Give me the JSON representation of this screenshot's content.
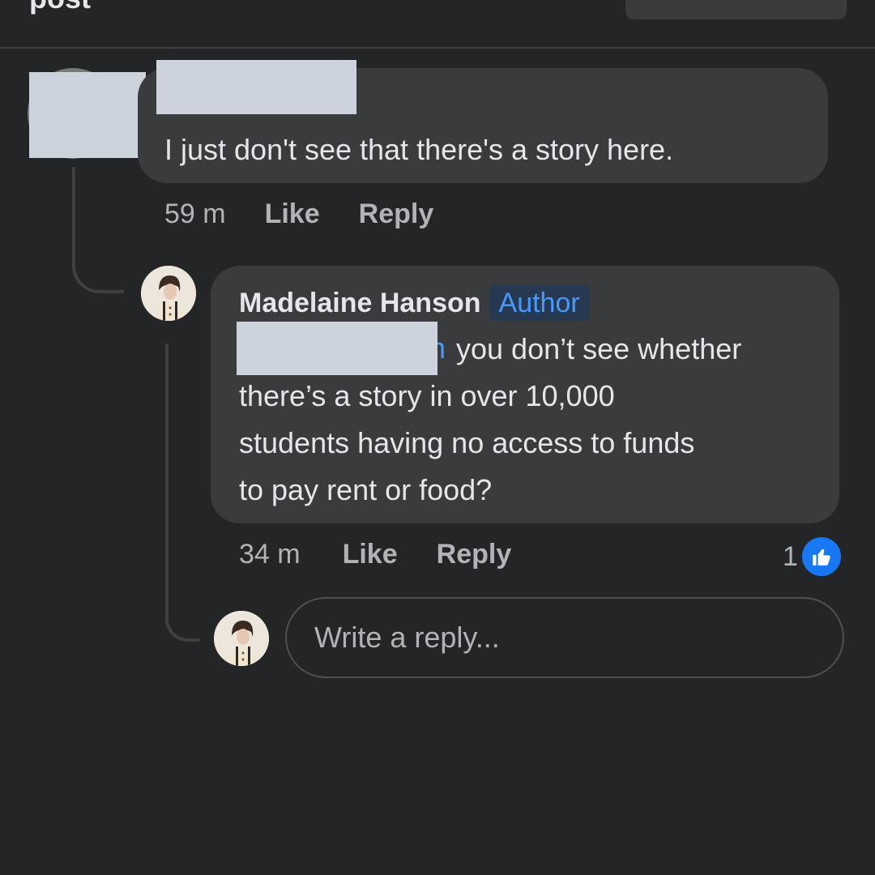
{
  "top": {
    "label": "post"
  },
  "comment": {
    "text": "I just don't see that there's a story here.",
    "timestamp": "59 m",
    "like_label": "Like",
    "reply_label": "Reply"
  },
  "reply": {
    "author_name": "Madelaine Hanson",
    "author_badge": "Author",
    "mention_fragment": "n",
    "lines": [
      "you don’t see whether",
      "there’s a story in over 10,000",
      "students having no access to funds",
      "to pay rent or food?"
    ],
    "timestamp": "34 m",
    "like_label": "Like",
    "reply_label": "Reply",
    "reaction_count": "1",
    "reaction_icon": "like-icon"
  },
  "composer": {
    "placeholder": "Write a reply..."
  },
  "colors": {
    "background": "#242526",
    "bubble": "#3a3b3c",
    "text": "#e4e6eb",
    "secondary_text": "#b0b3b8",
    "link": "#4599ff",
    "like_blue": "#1877f2",
    "redaction": "#ccd3dd"
  }
}
